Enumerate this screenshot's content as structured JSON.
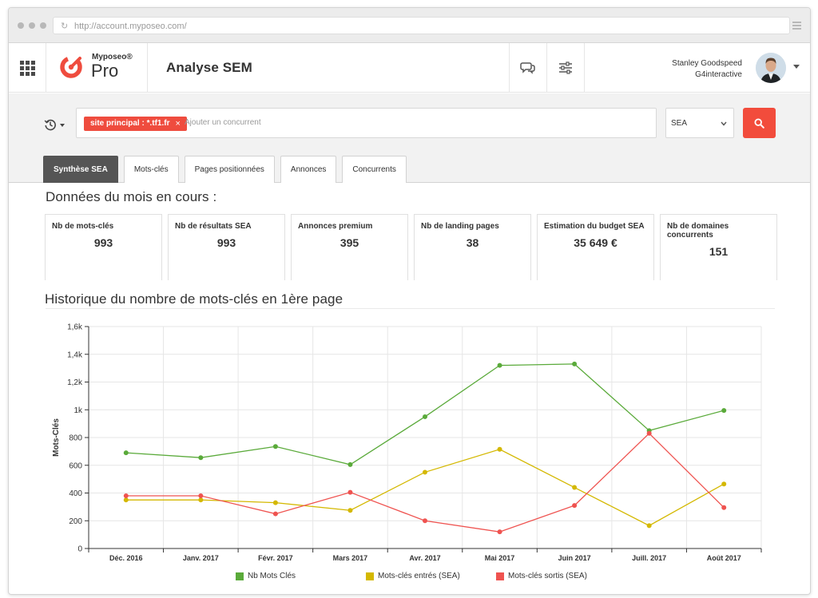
{
  "browser": {
    "url": "http://account.myposeo.com/"
  },
  "header": {
    "brand_name": "Myposeo®",
    "brand_product": "Pro",
    "page_title": "Analyse SEM",
    "user_name": "Stanley Goodspeed",
    "user_company": "G4interactive"
  },
  "toolbar": {
    "site_tag": "site principal : *.tf1.fr",
    "tag_close": "×",
    "search_placeholder": "Ajouter un concurrent",
    "select_value": "SEA",
    "tabs": [
      {
        "label": "Synthèse SEA",
        "active": true
      },
      {
        "label": "Mots-clés",
        "active": false
      },
      {
        "label": "Pages positionnées",
        "active": false
      },
      {
        "label": "Annonces",
        "active": false
      },
      {
        "label": "Concurrents",
        "active": false
      }
    ]
  },
  "summary": {
    "title": "Données du mois en cours :",
    "cards": [
      {
        "label": "Nb de mots-clés",
        "value": "993"
      },
      {
        "label": "Nb de résultats SEA",
        "value": "993"
      },
      {
        "label": "Annonces premium",
        "value": "395"
      },
      {
        "label": "Nb de landing pages",
        "value": "38"
      },
      {
        "label": "Estimation du budget SEA",
        "value": "35 649 €"
      },
      {
        "label": "Nb de domaines concurrents",
        "value": "151"
      }
    ]
  },
  "history": {
    "title": "Historique du nombre de mots-clés en 1ère page"
  },
  "colors": {
    "accent": "#f24c3c",
    "series_green": "#5aaa3a",
    "series_yellow": "#d4b800",
    "series_red": "#ef5350"
  },
  "chart_data": {
    "type": "line",
    "title": "Historique du nombre de mots-clés en 1ère page",
    "xlabel": "",
    "ylabel": "Mots-Clés",
    "ylim": [
      0,
      1600
    ],
    "yticks": [
      "0",
      "200",
      "400",
      "600",
      "800",
      "1k",
      "1,2k",
      "1,4k",
      "1,6k"
    ],
    "ytick_values": [
      0,
      200,
      400,
      600,
      800,
      1000,
      1200,
      1400,
      1600
    ],
    "categories": [
      "Déc. 2016",
      "Janv. 2017",
      "Févr. 2017",
      "Mars 2017",
      "Avr. 2017",
      "Mai 2017",
      "Juin 2017",
      "Juill. 2017",
      "Août 2017"
    ],
    "grid": true,
    "legend_position": "bottom",
    "series": [
      {
        "name": "Nb Mots Clés",
        "color": "#5aaa3a",
        "values": [
          690,
          655,
          735,
          605,
          950,
          1320,
          1330,
          850,
          995
        ]
      },
      {
        "name": "Mots-clés entrés (SEA)",
        "color": "#d4b800",
        "values": [
          350,
          350,
          330,
          275,
          550,
          715,
          440,
          165,
          465
        ]
      },
      {
        "name": "Mots-clés sortis (SEA)",
        "color": "#ef5350",
        "values": [
          380,
          380,
          250,
          405,
          200,
          120,
          310,
          830,
          295
        ]
      }
    ]
  }
}
